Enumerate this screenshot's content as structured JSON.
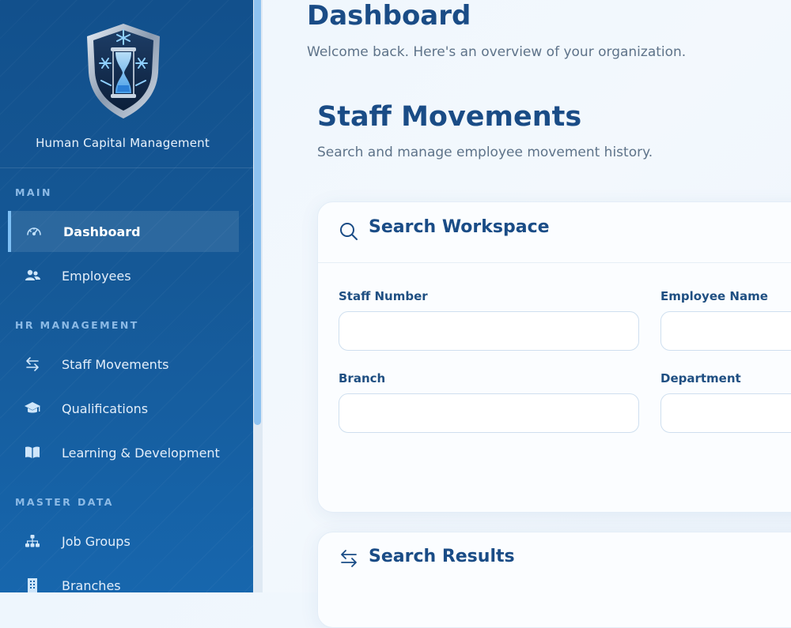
{
  "sidebar": {
    "brand_name": "Human Capital Management",
    "sections": [
      {
        "label": "MAIN"
      },
      {
        "label": "HR MANAGEMENT"
      },
      {
        "label": "MASTER DATA"
      }
    ],
    "items": [
      {
        "label": "Dashboard",
        "icon": "speedometer-icon",
        "active": true
      },
      {
        "label": "Employees",
        "icon": "users-icon"
      },
      {
        "label": "Staff Movements",
        "icon": "transfer-arrows-icon"
      },
      {
        "label": "Qualifications",
        "icon": "graduation-cap-icon"
      },
      {
        "label": "Learning & Development",
        "icon": "book-icon"
      },
      {
        "label": "Job Groups",
        "icon": "hierarchy-icon"
      },
      {
        "label": "Branches",
        "icon": "building-icon"
      }
    ]
  },
  "header": {
    "title": "Dashboard",
    "subtitle": "Welcome back. Here's an overview of your organization."
  },
  "section": {
    "title": "Staff Movements",
    "subtitle": "Search and manage employee movement history."
  },
  "search_card": {
    "title": "Search Workspace",
    "icon": "search-icon",
    "fields": [
      {
        "label": "Staff Number",
        "value": "",
        "placeholder": ""
      },
      {
        "label": "Employee Name",
        "value": "",
        "placeholder": ""
      },
      {
        "label": "Branch",
        "value": "",
        "placeholder": ""
      },
      {
        "label": "Department",
        "value": "",
        "placeholder": ""
      }
    ]
  },
  "results_card": {
    "title": "Search Results",
    "icon": "transfer-arrows-icon"
  },
  "colors": {
    "sidebar": "#155896",
    "accent": "#1a4c86",
    "active_indicator": "#7ec0f5"
  }
}
